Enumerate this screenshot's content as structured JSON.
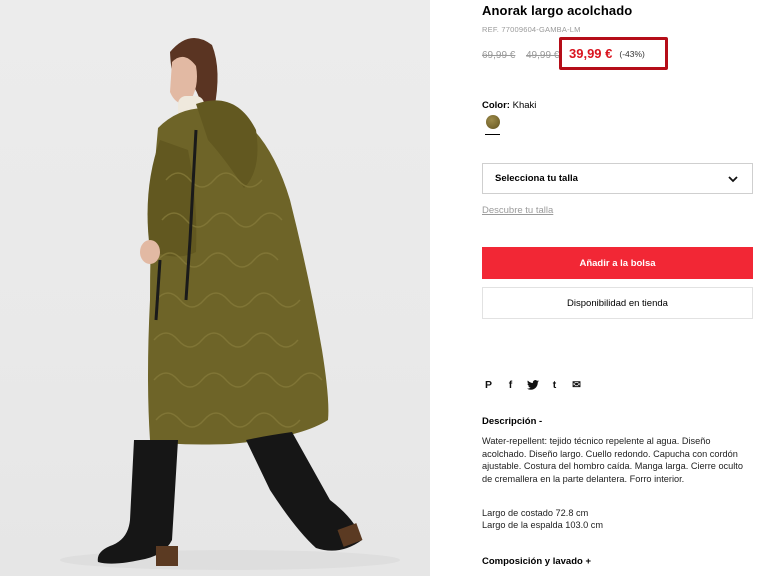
{
  "product": {
    "title": "Anorak largo acolchado",
    "ref": "REF. 77009604-GAMBA-LM",
    "prices": {
      "original": "69,99 €",
      "previous": "49,99 €",
      "current": "39,99 €",
      "discount": "(-43%)"
    },
    "color": {
      "label": "Color:",
      "value": "Khaki",
      "swatch_color": "#7a6a30"
    }
  },
  "size": {
    "placeholder": "Selecciona tu talla",
    "guide_link": "Descubre tu talla"
  },
  "actions": {
    "add_to_bag": "Añadir a la bolsa",
    "store_availability": "Disponibilidad en tienda"
  },
  "share": {
    "icons": [
      "pinterest-icon",
      "facebook-icon",
      "twitter-icon",
      "tumblr-icon",
      "email-icon"
    ],
    "glyphs": [
      "P",
      "f",
      "t",
      "t",
      "✉"
    ]
  },
  "description": {
    "title": "Descripción -",
    "body": "Water-repellent: tejido técnico repelente al agua. Diseño acolchado. Diseño largo. Cuello redondo. Capucha con cordón ajustable. Costura del hombro caída. Manga larga. Cierre oculto de cremallera en la parte delantera. Forro interior.",
    "measure_1": "Largo de costado 72.8 cm",
    "measure_2": "Largo de la espalda 103.0 cm"
  },
  "composition": {
    "title": "Composición y lavado +"
  },
  "colors": {
    "accent_red": "#f22735",
    "highlight_box": "#b50d18",
    "price_red": "#d9141f",
    "coat_khaki": "#6e6428"
  }
}
